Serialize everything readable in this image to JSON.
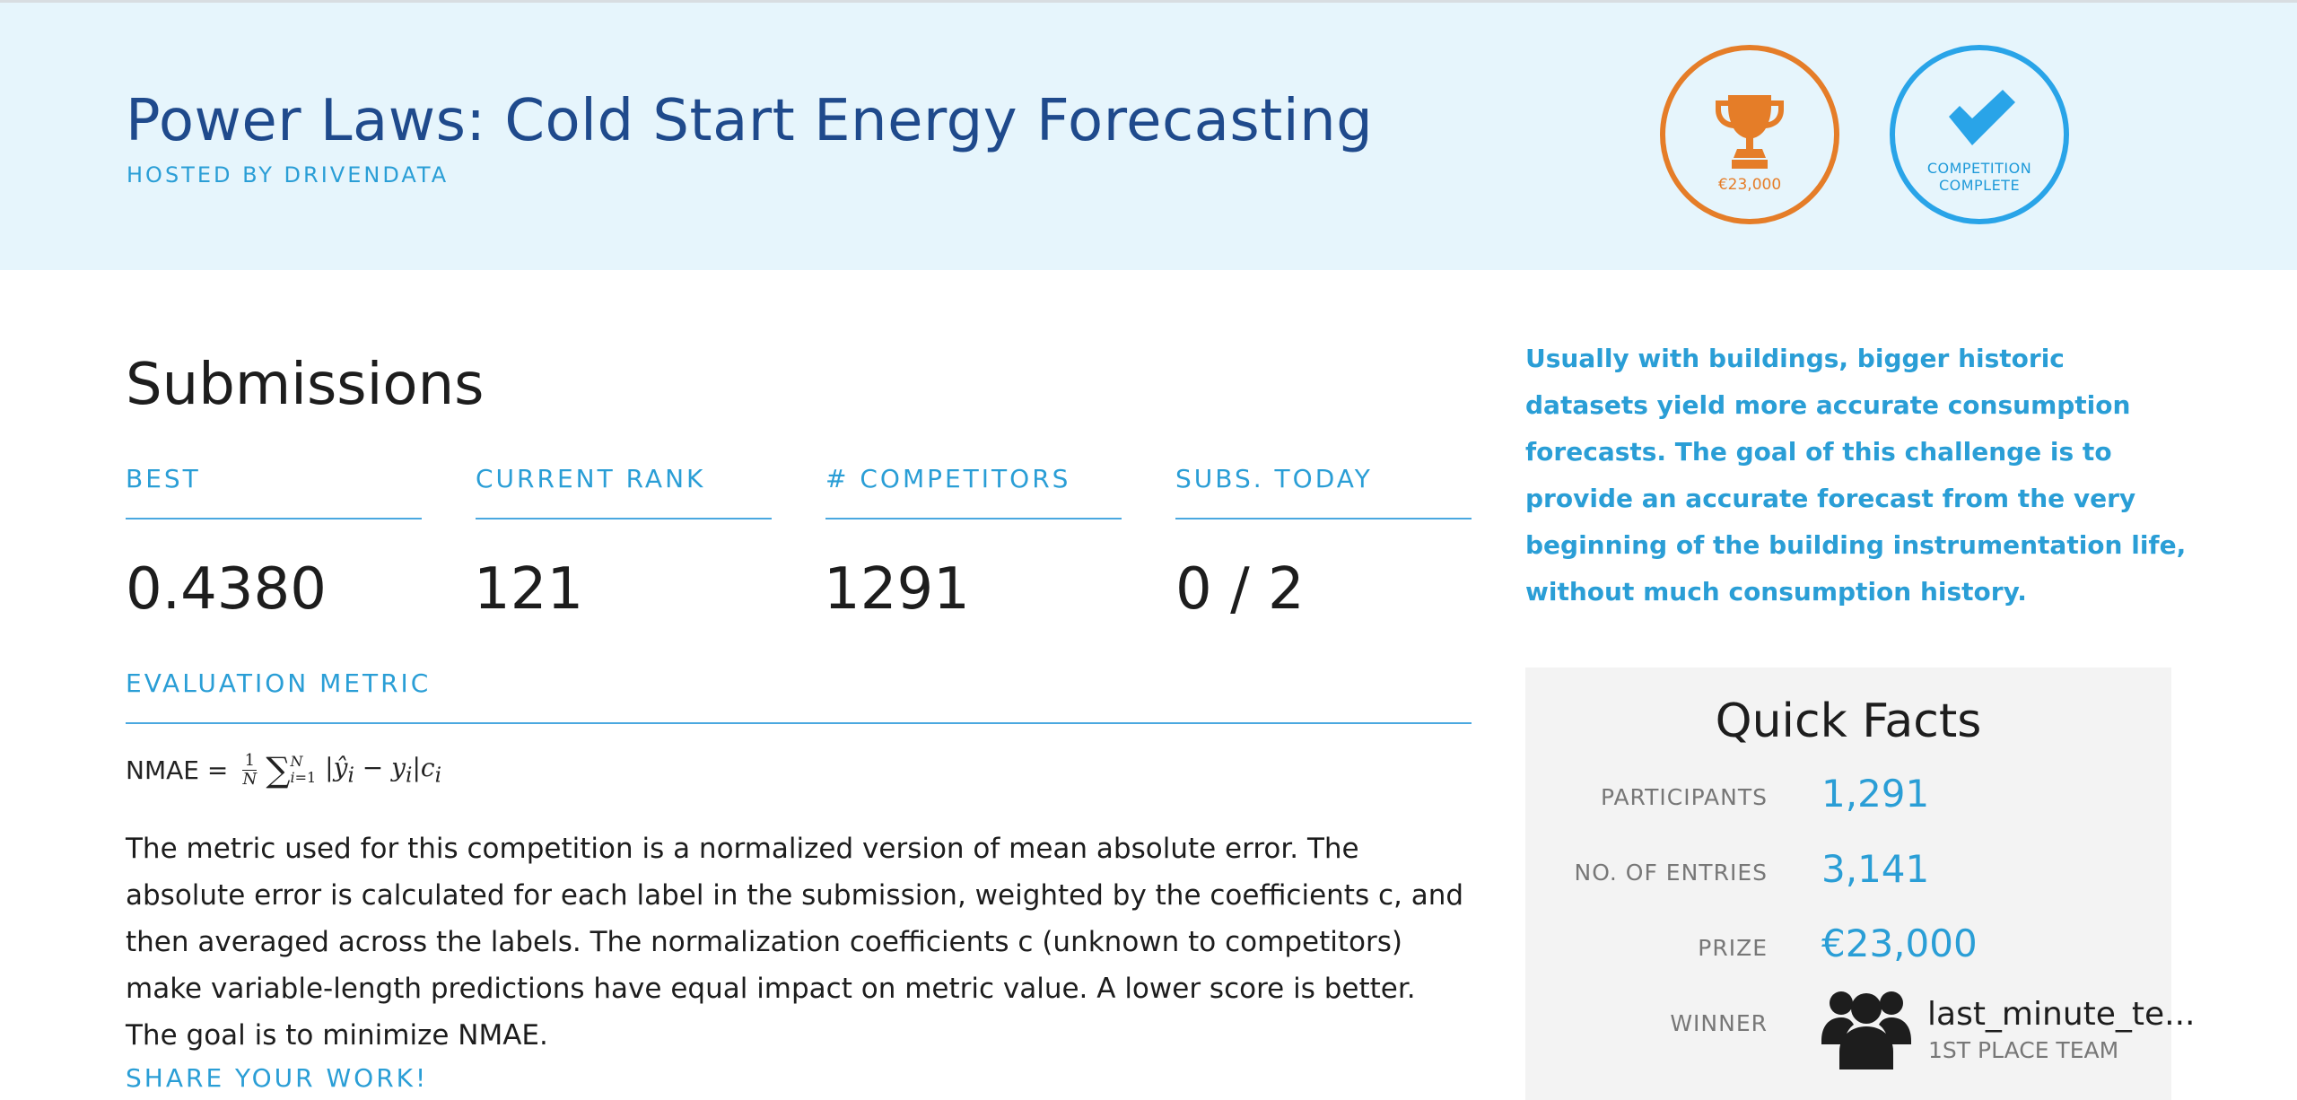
{
  "header": {
    "title": "Power Laws: Cold Start Energy Forecasting",
    "hosted_by": "HOSTED BY DRIVENDATA",
    "prize_badge": {
      "amount": "€23,000",
      "icon": "trophy-icon",
      "color": "#e57d28"
    },
    "status_badge": {
      "line1": "COMPETITION",
      "line2": "COMPLETE",
      "icon": "checkmark-icon",
      "color": "#29a4e8"
    }
  },
  "submissions": {
    "heading": "Submissions",
    "stats": [
      {
        "label": "BEST",
        "value": "0.4380"
      },
      {
        "label": "CURRENT RANK",
        "value": "121"
      },
      {
        "label": "# COMPETITORS",
        "value": "1291"
      },
      {
        "label": "SUBS. TODAY",
        "value": "0 / 2"
      }
    ]
  },
  "evaluation": {
    "heading": "EVALUATION METRIC",
    "formula_name": "NMAE =",
    "description": "The metric used for this competition is a normalized version of mean absolute error. The absolute error is calculated for each label in the submission, weighted by the coefficients c, and then averaged across the labels. The normalization coefficients c (unknown to competitors) make variable-length predictions have equal impact on metric value. A lower score is better. The goal is to minimize NMAE."
  },
  "share_heading": "SHARE YOUR WORK!",
  "blurb": "Usually with buildings, bigger historic datasets yield more accurate consumption forecasts. The goal of this challenge is to provide an accurate forecast from the very beginning of the building instrumentation life, without much consumption history.",
  "quick_facts": {
    "title": "Quick Facts",
    "rows": [
      {
        "label": "PARTICIPANTS",
        "value": "1,291"
      },
      {
        "label": "NO. OF ENTRIES",
        "value": "3,141"
      },
      {
        "label": "PRIZE",
        "value": "€23,000"
      }
    ],
    "winner": {
      "label": "WINNER",
      "name": "last_minute_te...",
      "subtitle": "1ST PLACE TEAM",
      "icon": "team-icon"
    }
  }
}
